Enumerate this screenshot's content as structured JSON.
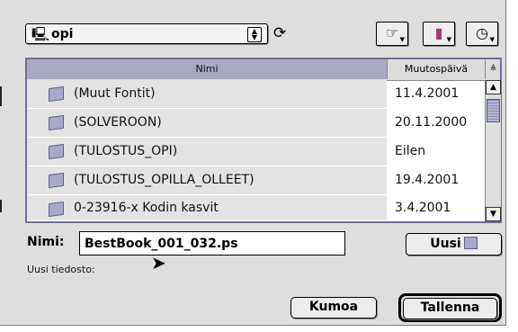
{
  "location": {
    "folder_name": "opi",
    "folder_icon": "desktop-folder-icon",
    "refresh_icon": "refresh-icon"
  },
  "toolbar": {
    "shortcuts_icon": "pointing-hand-icon",
    "favorites_icon": "favorites-book-icon",
    "recent_icon": "clock-icon"
  },
  "file_list": {
    "columns": {
      "name": "Nimi",
      "date": "Muutospäivä",
      "sort_glyph": "≜"
    },
    "rows": [
      {
        "name": "(Muut Fontit)",
        "date": "11.4.2001"
      },
      {
        "name": "(SOLVEROON)",
        "date": "20.11.2000"
      },
      {
        "name": "(TULOSTUS_OPI)",
        "date": "Eilen"
      },
      {
        "name": "(TULOSTUS_OPILLA_OLLEET)",
        "date": "19.4.2001"
      },
      {
        "name": "0-23916-x Kodin kasvit",
        "date": "3.4.2001"
      }
    ]
  },
  "save": {
    "name_label": "Nimi:",
    "file_name": "BestBook_001_032.ps",
    "new_folder_label": "Uusi",
    "hint": "Uusi tiedosto:",
    "cancel_label": "Kumoa",
    "save_label": "Tallenna"
  },
  "colors": {
    "list_border": "#6e6e92",
    "name_header": "#a9a9c1",
    "folder": "#a8a8cc",
    "dialog_bg": "#dedede"
  }
}
